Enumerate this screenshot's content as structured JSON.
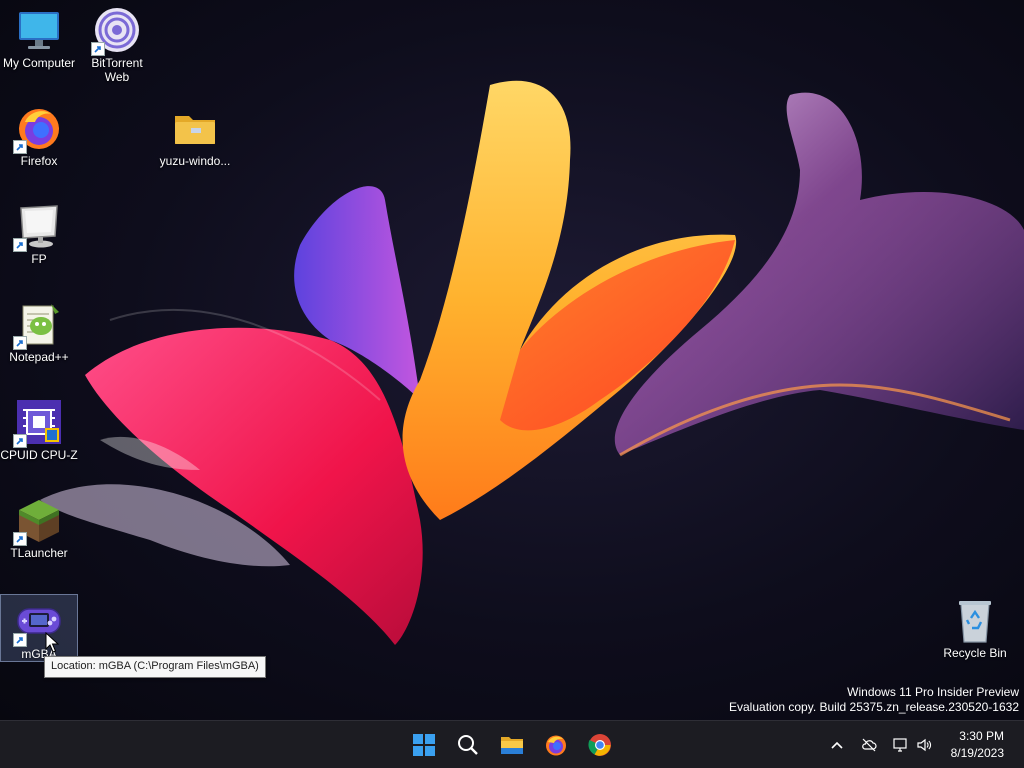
{
  "desktop_icons": [
    {
      "label": "My Computer",
      "icon": "monitor-icon",
      "shortcut": false
    },
    {
      "label": "BitTorrent Web",
      "icon": "bittorrent-icon",
      "shortcut": true
    },
    {
      "label": "Firefox",
      "icon": "firefox-icon",
      "shortcut": true
    },
    {
      "label": "yuzu-windo...",
      "icon": "folder-icon",
      "shortcut": false
    },
    {
      "label": "FP",
      "icon": "fp-monitor-icon",
      "shortcut": true
    },
    {
      "label": "Notepad++",
      "icon": "notepadpp-icon",
      "shortcut": true
    },
    {
      "label": "CPUID CPU-Z",
      "icon": "cpuz-icon",
      "shortcut": true
    },
    {
      "label": "TLauncher",
      "icon": "grass-block-icon",
      "shortcut": true
    },
    {
      "label": "mGBA",
      "icon": "gameboy-advance-icon",
      "shortcut": true,
      "selected": true
    },
    {
      "label": "Recycle Bin",
      "icon": "recycle-bin-icon",
      "shortcut": false
    }
  ],
  "tooltip": {
    "text": "Location: mGBA (C:\\Program Files\\mGBA)"
  },
  "watermark": {
    "line1": "Windows 11 Pro Insider Preview",
    "line2": "Evaluation copy. Build 25375.zn_release.230520-1632"
  },
  "taskbar": {
    "pinned": [
      "start-icon",
      "search-icon",
      "file-explorer-icon",
      "firefox-icon",
      "chrome-icon"
    ],
    "tray": [
      "chevron-up-icon",
      "cloud-offline-icon",
      "network-icon",
      "volume-icon"
    ],
    "clock": {
      "time": "3:30 PM",
      "date": "8/19/2023"
    }
  },
  "colors": {
    "taskbar_bg": "#1c1c22",
    "start_blue": "#3aa0f0",
    "folder_yellow": "#f3c34a"
  }
}
